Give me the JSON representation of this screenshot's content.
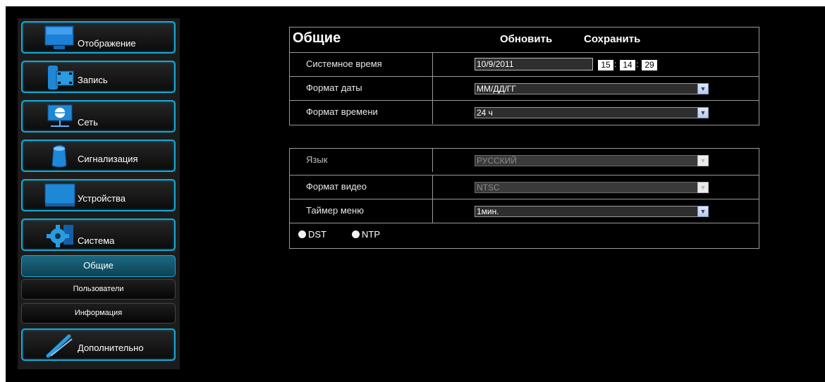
{
  "sidebar": {
    "items": [
      {
        "label": "Отображение",
        "icon": "monitor-icon"
      },
      {
        "label": "Запись",
        "icon": "film-record-icon"
      },
      {
        "label": "Сеть",
        "icon": "network-globe-icon"
      },
      {
        "label": "Сигнализация",
        "icon": "alarm-siren-icon"
      },
      {
        "label": "Устройства",
        "icon": "device-screen-icon"
      },
      {
        "label": "Система",
        "icon": "gear-icon"
      }
    ],
    "sub_items": [
      {
        "label": "Общие",
        "active": true
      },
      {
        "label": "Пользователи",
        "active": false
      },
      {
        "label": "Информация",
        "active": false
      }
    ],
    "advanced": {
      "label": "Дополнительно",
      "icon": "wrench-screwdriver-icon"
    }
  },
  "general": {
    "title": "Общие",
    "refresh_label": "Обновить",
    "save_label": "Сохранить",
    "system_time": {
      "label": "Системное время",
      "date": "10/9/2011",
      "hour": "15",
      "minute": "14",
      "second": "29",
      "separator": ":"
    },
    "date_format": {
      "label": "Формат даты",
      "value": "ММ/ДД/ГГ"
    },
    "time_format": {
      "label": "Формат времени",
      "value": "24 ч"
    }
  },
  "settings": {
    "language": {
      "label": "Язык",
      "value": "РУССКИЙ",
      "disabled": true
    },
    "video_format": {
      "label": "Формат видео",
      "value": "NTSC",
      "disabled": true
    },
    "menu_timer": {
      "label": "Таймер меню",
      "value": "1мин."
    },
    "dst_label": "DST",
    "ntp_label": "NTP"
  },
  "colors": {
    "accent": "#1aa6cf",
    "background": "#000000",
    "active_tab": "#1b6882"
  }
}
